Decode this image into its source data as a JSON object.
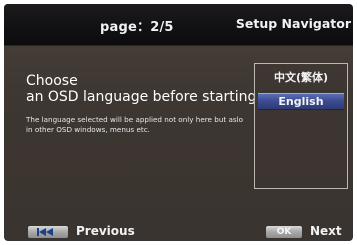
{
  "header": {
    "page_indicator": "page：2/5",
    "title": "Setup Navigator"
  },
  "main": {
    "heading_line1": "Choose",
    "heading_line2": "an OSD language before starting.",
    "note": "The language selected will be applied not only here but aslo in other OSD windows, menus etc."
  },
  "languages": {
    "items": [
      {
        "label": "中文(繁体)",
        "selected": false
      },
      {
        "label": "English",
        "selected": true
      }
    ]
  },
  "footer": {
    "previous_label": "Previous",
    "ok_label": "OK",
    "next_label": "Next",
    "previous_icon": "skip-previous-icon"
  },
  "colors": {
    "selection": "#3c4d91",
    "background": "#3d3631",
    "header": "#111012"
  }
}
